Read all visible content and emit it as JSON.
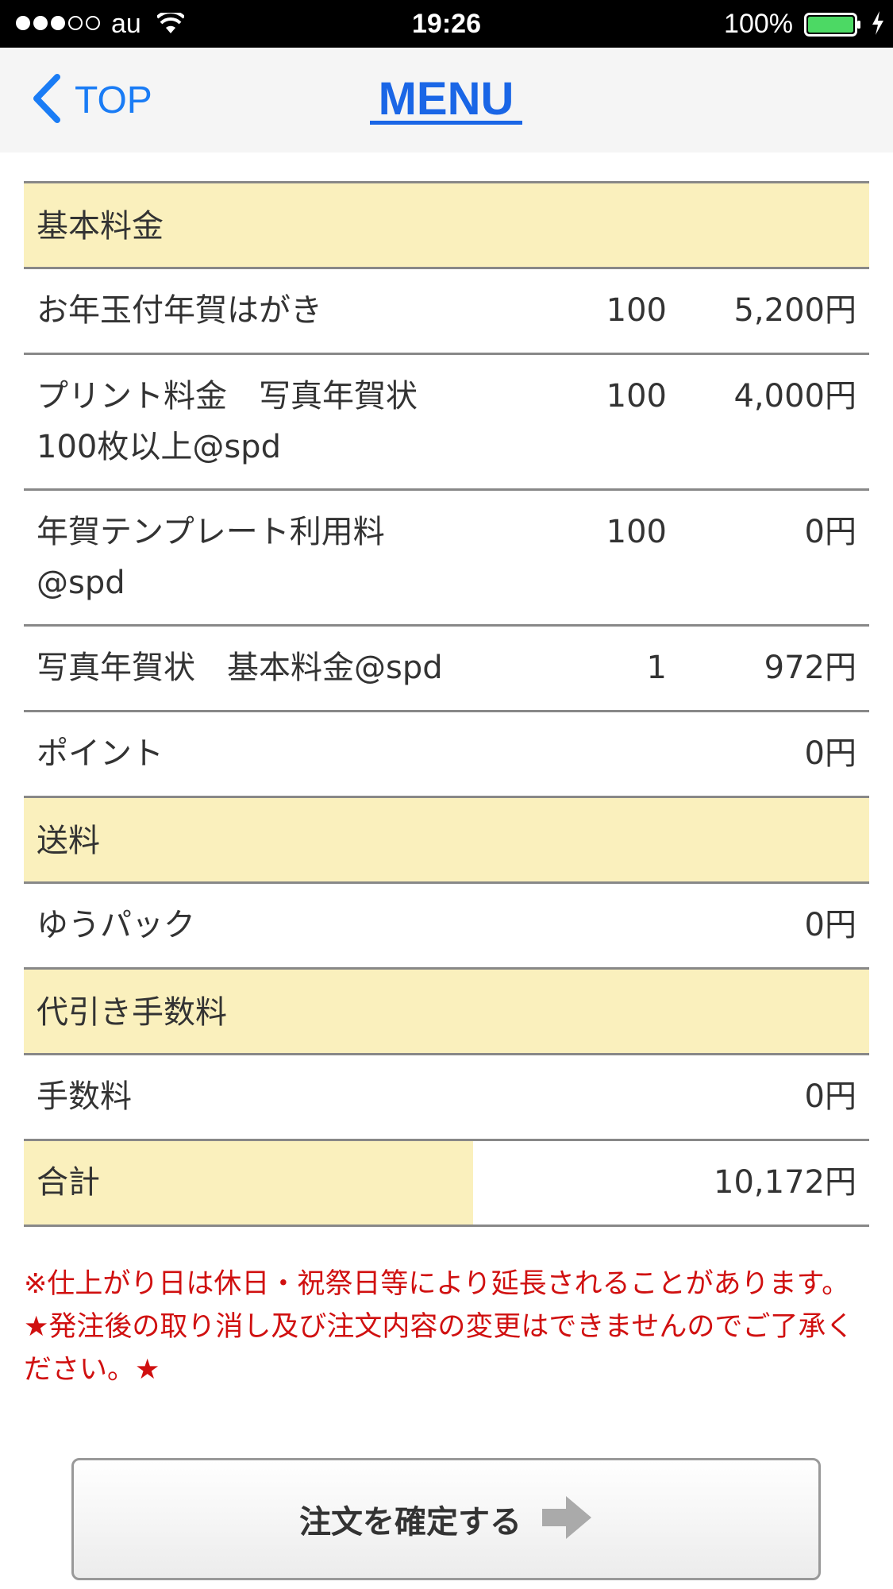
{
  "status_bar": {
    "carrier": "au",
    "time": "19:26",
    "battery_percent": "100%",
    "signal_strength": 3,
    "signal_max": 5,
    "battery_level": 1.0
  },
  "nav": {
    "back_label": "TOP",
    "title": "MENU",
    "accent_color": "#1a66e6"
  },
  "table": {
    "rows": [
      {
        "type": "section",
        "name": "基本料金"
      },
      {
        "type": "item",
        "name": "お年玉付年賀はがき",
        "qty": "100",
        "amount": "5,200円"
      },
      {
        "type": "item",
        "name": "プリント料金　写真年賀状100枚以上@spd",
        "qty": "100",
        "amount": "4,000円"
      },
      {
        "type": "item",
        "name": "年賀テンプレート利用料@spd",
        "qty": "100",
        "amount": "0円"
      },
      {
        "type": "item",
        "name": "写真年賀状　基本料金@spd",
        "qty": "1",
        "amount": "972円"
      },
      {
        "type": "item",
        "name": "ポイント",
        "qty": "",
        "amount": "0円"
      },
      {
        "type": "section",
        "name": "送料"
      },
      {
        "type": "item",
        "name": "ゆうパック",
        "qty": "",
        "amount": "0円"
      },
      {
        "type": "section",
        "name": "代引き手数料"
      },
      {
        "type": "item",
        "name": "手数料",
        "qty": "",
        "amount": "0円"
      }
    ],
    "total": {
      "label": "合計",
      "amount": "10,172円"
    },
    "section_color": "#faf0bd"
  },
  "notices": {
    "line1": "※仕上がり日は休日・祝祭日等により延長されることがあります。",
    "line2": "★発注後の取り消し及び注文内容の変更はできませんのでご了承ください。★",
    "color": "#d01010"
  },
  "confirm": {
    "label": "注文を確定する",
    "icon": "arrow-right-icon"
  }
}
